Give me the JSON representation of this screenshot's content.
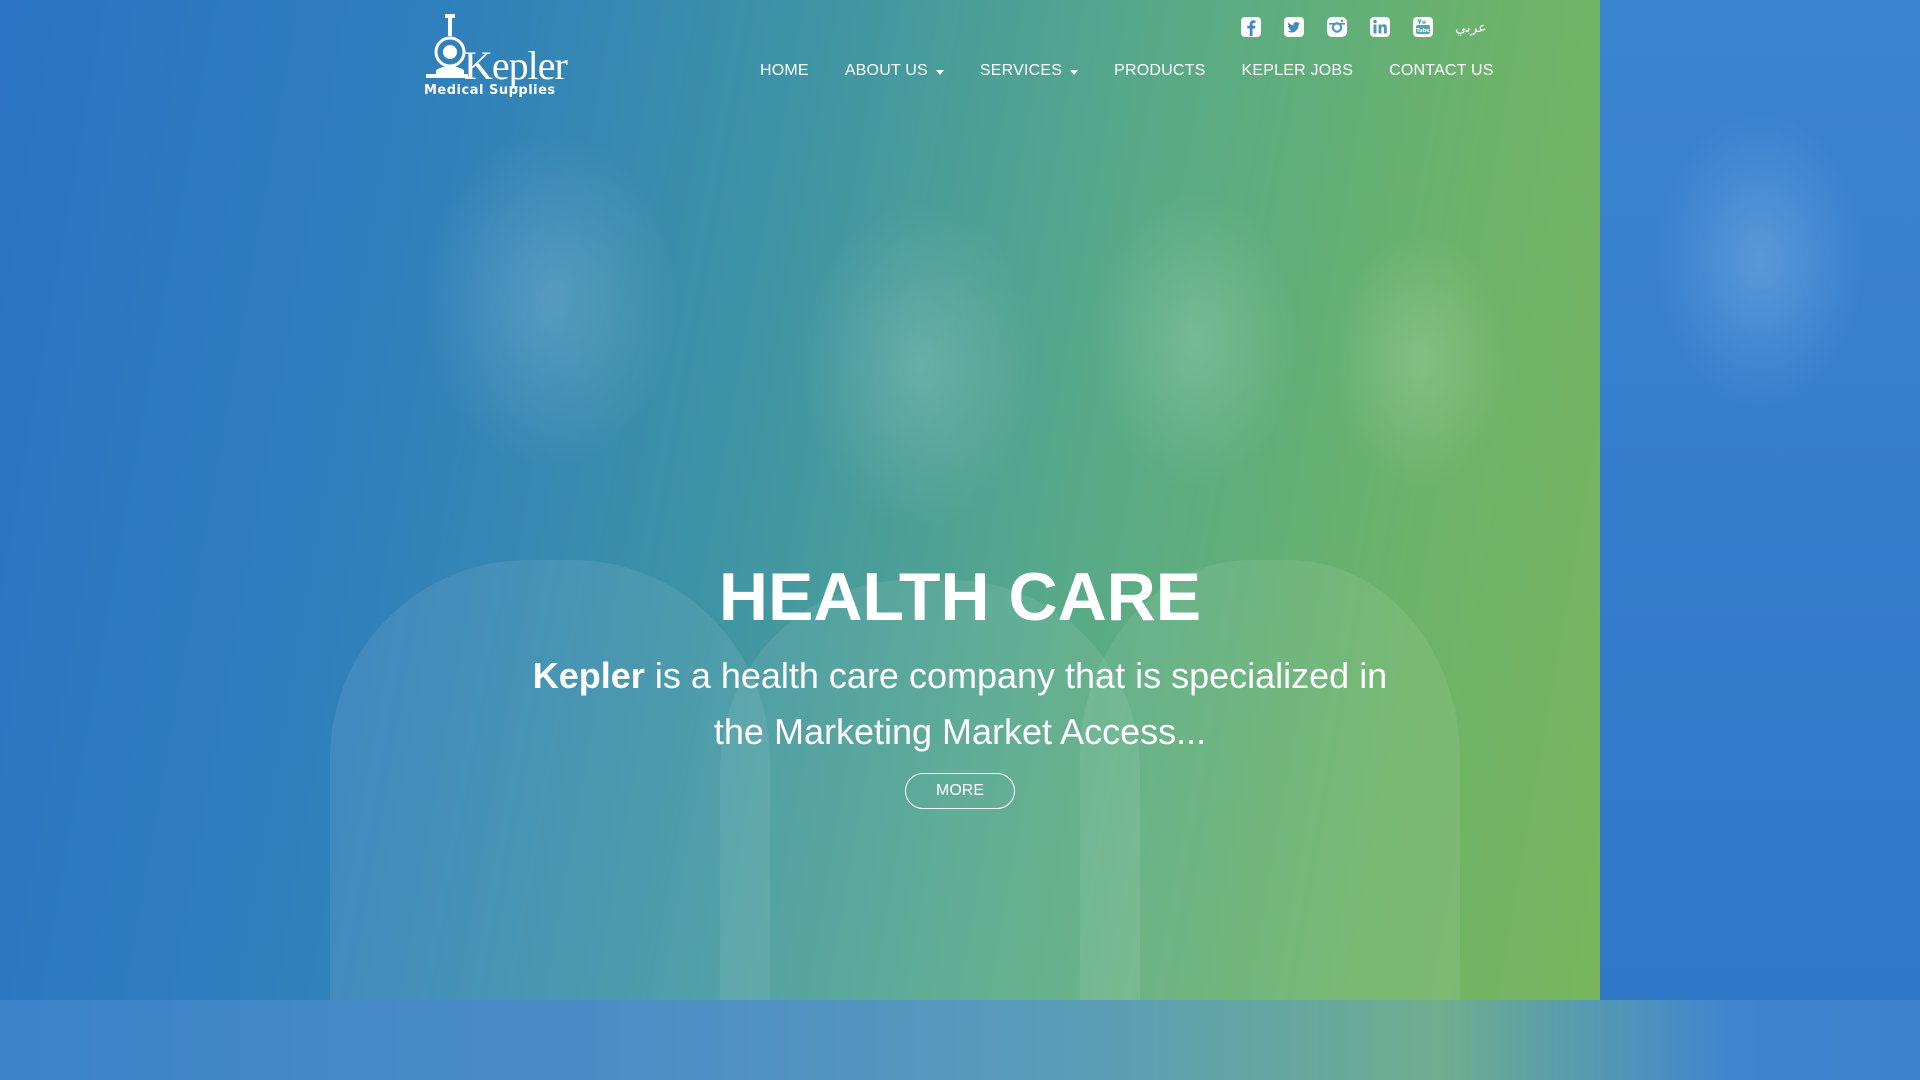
{
  "brand": {
    "wordmark": "Kepler",
    "subtitle": "Medical Supplies"
  },
  "social": {
    "icons": [
      "facebook-icon",
      "twitter-icon",
      "instagram-icon",
      "linkedin-icon",
      "youtube-icon"
    ],
    "language_link": "عربي"
  },
  "nav": {
    "items": [
      {
        "label": "HOME",
        "has_dropdown": false
      },
      {
        "label": "ABOUT US",
        "has_dropdown": true
      },
      {
        "label": "SERVICES",
        "has_dropdown": true
      },
      {
        "label": "PRODUCTS",
        "has_dropdown": false
      },
      {
        "label": "KEPLER JOBS",
        "has_dropdown": false
      },
      {
        "label": "CONTACT US",
        "has_dropdown": false
      }
    ]
  },
  "hero": {
    "headline": "HEALTH CARE",
    "tagline_brand": "Kepler",
    "tagline_rest": " is a health care company that is specialized in the Marketing Market Access...",
    "cta_label": "MORE"
  },
  "colors": {
    "gradient_start": "#2a74c3",
    "gradient_end": "#78b55e",
    "text": "#ffffff"
  }
}
